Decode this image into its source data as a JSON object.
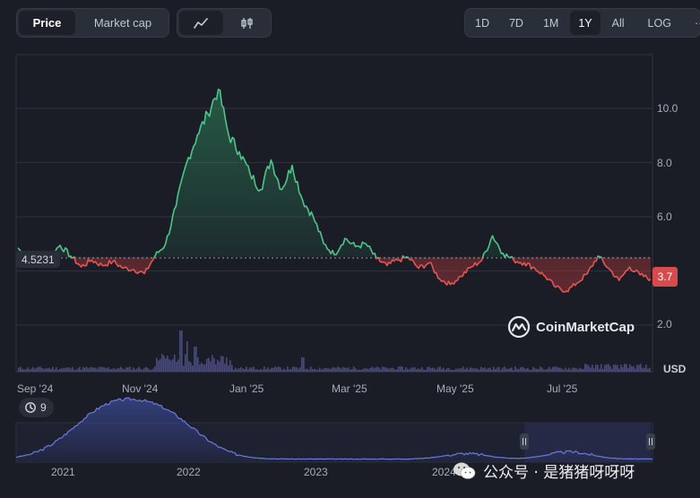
{
  "toolbar": {
    "view_tabs": [
      {
        "label": "Price",
        "active": true
      },
      {
        "label": "Market cap",
        "active": false
      }
    ],
    "chart_type_icons": [
      "line-chart-icon",
      "candlestick-icon"
    ],
    "ranges": [
      "1D",
      "7D",
      "1M",
      "1Y",
      "All"
    ],
    "active_range": "1Y",
    "log_label": "LOG",
    "more_label": "···"
  },
  "price_chart": {
    "reference_price": "4.5231",
    "current_price": "3.7",
    "currency": "USD",
    "events_count": "9",
    "watermark": "CoinMarketCap",
    "colors": {
      "up": "#4fc48a",
      "down": "#e25553",
      "volume": "#4a4d78"
    }
  },
  "chart_data": {
    "type": "line",
    "xlabel": "",
    "ylabel": "USD",
    "ylim": [
      1.2,
      12.8
    ],
    "yticks": [
      "10.0",
      "8.0",
      "6.0",
      "2.0"
    ],
    "xtick_labels": [
      "Sep '24",
      "Nov '24",
      "Jan '25",
      "Mar '25",
      "May '25",
      "Jul '25"
    ],
    "baseline": 4.5231,
    "series": [
      {
        "values": [
          4.85,
          4.4,
          4.2,
          4.55,
          4.95,
          4.55,
          4.15,
          4.4,
          4.2,
          4.35,
          4.1,
          4.05,
          3.9,
          4.55,
          5.0,
          6.4,
          8.0,
          9.0,
          9.8,
          10.7,
          9.0,
          8.4,
          7.6,
          7.0,
          8.1,
          7.0,
          7.9,
          6.6,
          6.0,
          5.0,
          4.6,
          5.2,
          4.9,
          5.0,
          4.45,
          4.2,
          4.4,
          4.5,
          4.1,
          4.3,
          3.7,
          3.5,
          3.8,
          4.15,
          4.4,
          5.3,
          4.65,
          4.4,
          4.3,
          4.1,
          3.8,
          3.4,
          3.25,
          3.55,
          3.9,
          4.55,
          4.1,
          3.65,
          4.15,
          3.85,
          3.7
        ]
      }
    ],
    "volume_spikes": [
      "Dec '24",
      "Dec '24",
      "Feb '25",
      "Mar '25"
    ]
  },
  "overview": {
    "year_labels": [
      "2021",
      "2022",
      "2023",
      "2024"
    ],
    "handle_icon": "drag-handle-icon"
  },
  "wechat_watermark": {
    "text": "公众号 · 是猪猪呀呀呀"
  }
}
